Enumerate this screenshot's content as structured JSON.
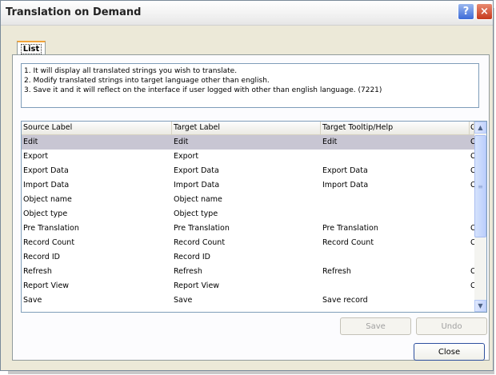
{
  "window": {
    "title": "Translation on Demand",
    "help_glyph": "?",
    "close_glyph": "×"
  },
  "tab": {
    "label": "List"
  },
  "info": {
    "lines": [
      "1. It will display all translated strings you wish to translate.",
      "2. Modify translated strings into target language other than english.",
      "3. Save it and it will reflect on the interface if user logged with other than english language. (7221)"
    ]
  },
  "grid": {
    "columns": [
      "Source Label",
      "Target Label",
      "Target Tooltip/Help",
      "C"
    ],
    "rows": [
      {
        "source": "Edit",
        "target": "Edit",
        "tooltip": "Edit",
        "extra": "C",
        "selected": true
      },
      {
        "source": "Export",
        "target": "Export",
        "tooltip": "",
        "extra": "C"
      },
      {
        "source": "Export Data",
        "target": "Export Data",
        "tooltip": "Export Data",
        "extra": "C"
      },
      {
        "source": "Import Data",
        "target": "Import Data",
        "tooltip": "Import Data",
        "extra": "C"
      },
      {
        "source": "Object name",
        "target": "Object name",
        "tooltip": "",
        "extra": ""
      },
      {
        "source": "Object type",
        "target": "Object type",
        "tooltip": "",
        "extra": ""
      },
      {
        "source": "Pre Translation",
        "target": "Pre Translation",
        "tooltip": "Pre Translation",
        "extra": "C"
      },
      {
        "source": "Record Count",
        "target": "Record Count",
        "tooltip": "Record Count",
        "extra": "C"
      },
      {
        "source": "Record ID",
        "target": "Record ID",
        "tooltip": "",
        "extra": ""
      },
      {
        "source": "Refresh",
        "target": "Refresh",
        "tooltip": "Refresh",
        "extra": "C"
      },
      {
        "source": "Report View",
        "target": "Report View",
        "tooltip": "",
        "extra": "C"
      },
      {
        "source": "Save",
        "target": "Save",
        "tooltip": "Save record",
        "extra": ""
      }
    ]
  },
  "buttons": {
    "save": "Save",
    "undo": "Undo",
    "close": "Close"
  },
  "colors": {
    "selected_row": "#c8c6d3",
    "tab_accent": "#f1a33a",
    "dialog_bg": "#ece9d8"
  }
}
